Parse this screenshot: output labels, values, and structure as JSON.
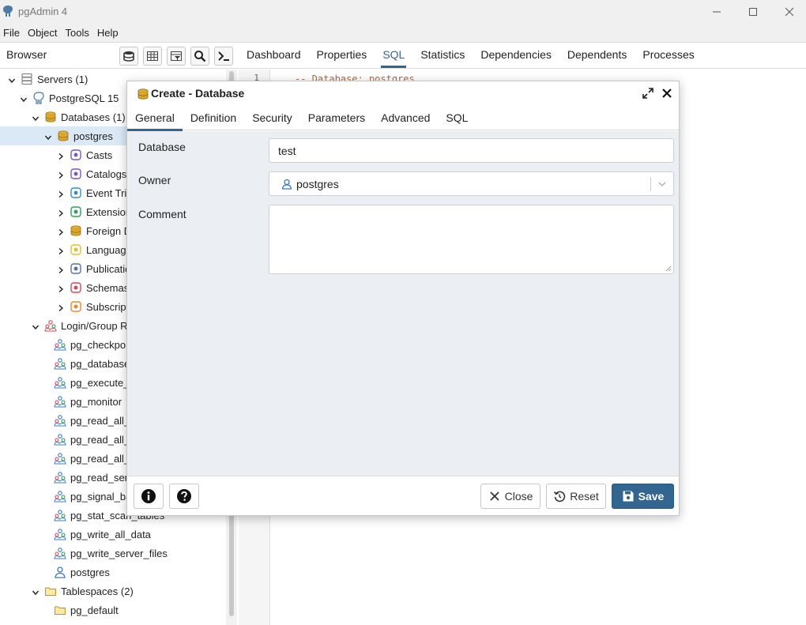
{
  "window": {
    "title": "pgAdmin 4",
    "controls": [
      "minimize-icon",
      "maximize-icon",
      "close-icon"
    ]
  },
  "menu": [
    "File",
    "Object",
    "Tools",
    "Help"
  ],
  "browser": {
    "label": "Browser",
    "toolbar_icons": [
      "database-icon",
      "table-icon",
      "filter-table-icon",
      "search-icon",
      "terminal-icon"
    ]
  },
  "main_tabs": [
    {
      "label": "Dashboard",
      "active": false
    },
    {
      "label": "Properties",
      "active": false
    },
    {
      "label": "SQL",
      "active": true
    },
    {
      "label": "Statistics",
      "active": false
    },
    {
      "label": "Dependencies",
      "active": false
    },
    {
      "label": "Dependents",
      "active": false
    },
    {
      "label": "Processes",
      "active": false
    }
  ],
  "tree": [
    {
      "label": "Servers (1)",
      "icon": "servers-icon",
      "level": 0,
      "chevron": "down"
    },
    {
      "label": "PostgreSQL 15",
      "icon": "elephant-icon",
      "level": 1,
      "chevron": "down"
    },
    {
      "label": "Databases (1)",
      "icon": "databases-icon",
      "level": 2,
      "chevron": "down"
    },
    {
      "label": "postgres",
      "icon": "database-icon",
      "level": 3,
      "chevron": "down",
      "selected": true
    },
    {
      "label": "Casts",
      "icon": "casts-icon",
      "level": 4,
      "chevron": "right"
    },
    {
      "label": "Catalogs",
      "icon": "catalogs-icon",
      "level": 4,
      "chevron": "right"
    },
    {
      "label": "Event Triggers",
      "icon": "event-trigger-icon",
      "level": 4,
      "chevron": "right"
    },
    {
      "label": "Extensions",
      "icon": "extension-icon",
      "level": 4,
      "chevron": "right"
    },
    {
      "label": "Foreign Data Wrappers",
      "icon": "foreign-data-icon",
      "level": 4,
      "chevron": "right"
    },
    {
      "label": "Languages",
      "icon": "language-icon",
      "level": 4,
      "chevron": "right"
    },
    {
      "label": "Publications",
      "icon": "publication-icon",
      "level": 4,
      "chevron": "right"
    },
    {
      "label": "Schemas",
      "icon": "schema-icon",
      "level": 4,
      "chevron": "right"
    },
    {
      "label": "Subscriptions",
      "icon": "subscription-icon",
      "level": 4,
      "chevron": "right"
    },
    {
      "label": "Login/Group Roles",
      "icon": "group-roles-icon",
      "level": 2,
      "chevron": "down"
    },
    {
      "label": "pg_checkpoint",
      "icon": "group-role-icon",
      "level": 3
    },
    {
      "label": "pg_database_owner",
      "icon": "group-role-icon",
      "level": 3
    },
    {
      "label": "pg_execute_server_program",
      "icon": "group-role-icon",
      "level": 3
    },
    {
      "label": "pg_monitor",
      "icon": "group-role-icon",
      "level": 3
    },
    {
      "label": "pg_read_all_data",
      "icon": "group-role-icon",
      "level": 3
    },
    {
      "label": "pg_read_all_settings",
      "icon": "group-role-icon",
      "level": 3
    },
    {
      "label": "pg_read_all_stats",
      "icon": "group-role-icon",
      "level": 3
    },
    {
      "label": "pg_read_server_files",
      "icon": "group-role-icon",
      "level": 3
    },
    {
      "label": "pg_signal_backend",
      "icon": "group-role-icon",
      "level": 3
    },
    {
      "label": "pg_stat_scan_tables",
      "icon": "group-role-icon",
      "level": 3
    },
    {
      "label": "pg_write_all_data",
      "icon": "group-role-icon",
      "level": 3
    },
    {
      "label": "pg_write_server_files",
      "icon": "group-role-icon",
      "level": 3
    },
    {
      "label": "postgres",
      "icon": "login-role-icon",
      "level": 3
    },
    {
      "label": "Tablespaces (2)",
      "icon": "tablespaces-icon",
      "level": 2,
      "chevron": "down"
    },
    {
      "label": "pg_default",
      "icon": "tablespace-icon",
      "level": 3
    }
  ],
  "editor": {
    "line_number": "1",
    "text": "-- Database: postgres"
  },
  "dialog": {
    "title": "Create - Database",
    "tabs": [
      {
        "label": "General",
        "active": true
      },
      {
        "label": "Definition",
        "active": false
      },
      {
        "label": "Security",
        "active": false
      },
      {
        "label": "Parameters",
        "active": false
      },
      {
        "label": "Advanced",
        "active": false
      },
      {
        "label": "SQL",
        "active": false
      }
    ],
    "fields": {
      "database": {
        "label": "Database",
        "value": "test"
      },
      "owner": {
        "label": "Owner",
        "value": "postgres"
      },
      "comment": {
        "label": "Comment",
        "value": ""
      }
    },
    "footer": {
      "info_icon": "info-icon",
      "help_icon": "help-icon",
      "close_label": "Close",
      "reset_label": "Reset",
      "save_label": "Save"
    }
  },
  "colors": {
    "accent": "#326690",
    "selected_row": "#dbe9f7",
    "dialog_body": "#ebeef3"
  }
}
